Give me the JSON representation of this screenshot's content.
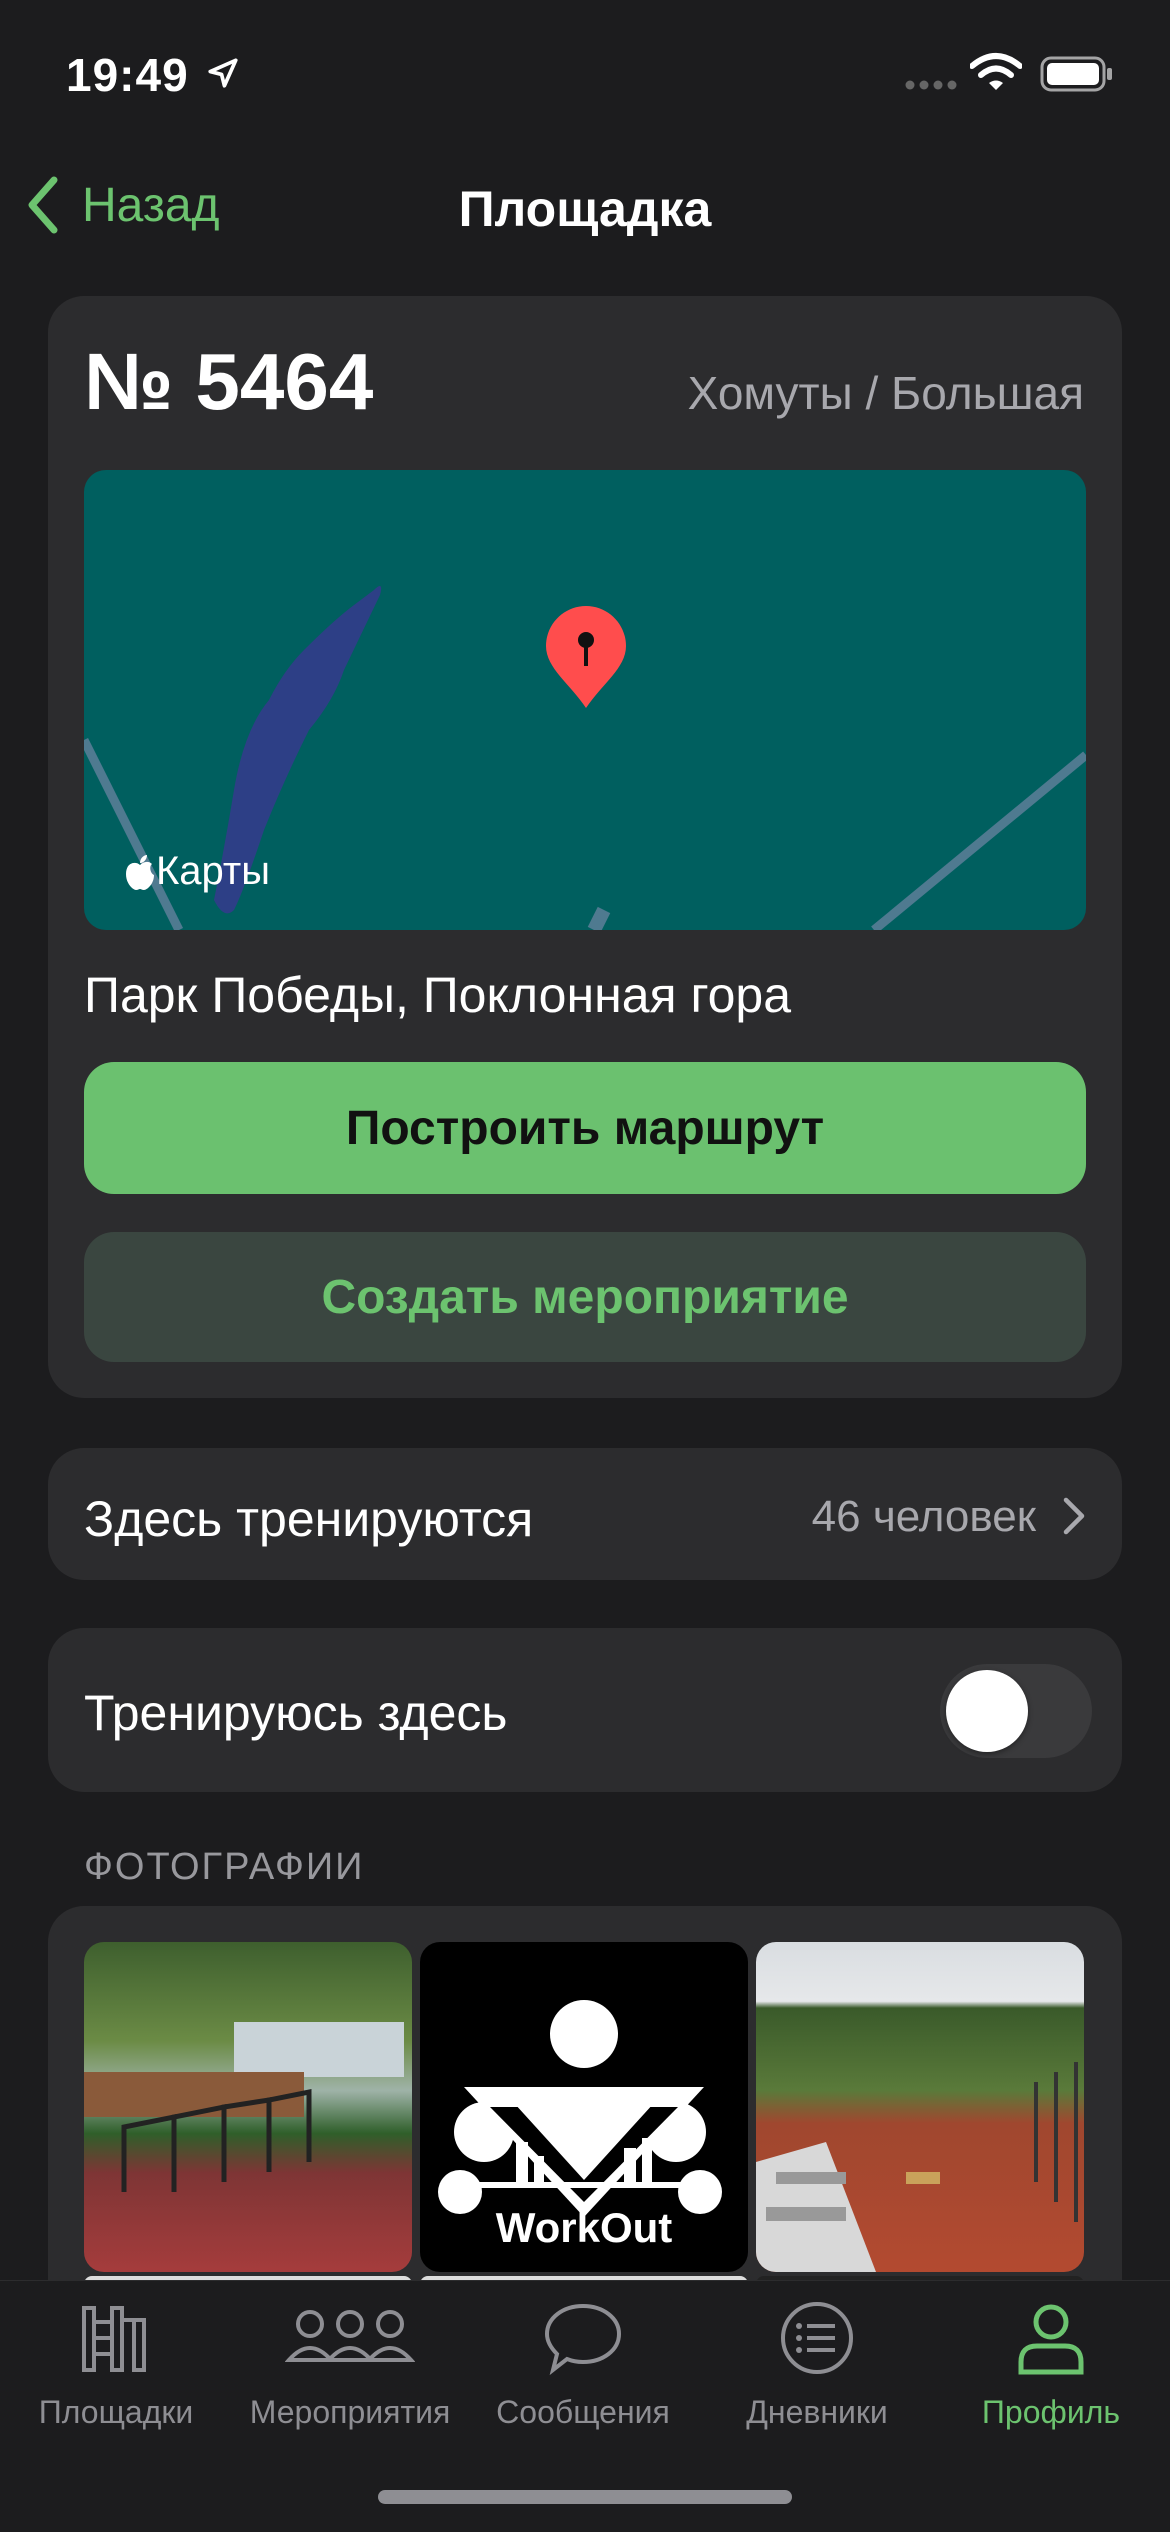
{
  "status_bar": {
    "time": "19:49"
  },
  "nav": {
    "back_label": "Назад",
    "title": "Площадка"
  },
  "ground": {
    "number": "№ 5464",
    "category": "Хомуты / Большая",
    "maps_label": "Карты",
    "address": "Парк Победы, Поклонная гора",
    "route_button": "Построить маршрут",
    "create_event_button": "Создать мероприятие"
  },
  "training_here": {
    "label": "Здесь тренируются",
    "count": "46 человек"
  },
  "train_toggle": {
    "label": "Тренируюсь здесь",
    "on": false
  },
  "photos": {
    "header": "ФОТОГРАФИИ",
    "workout_logo_text": "WorkOut"
  },
  "tabs": [
    {
      "label": "Площадки",
      "icon": "ladder-icon"
    },
    {
      "label": "Мероприятия",
      "icon": "people-icon"
    },
    {
      "label": "Сообщения",
      "icon": "chat-bubble-icon"
    },
    {
      "label": "Дневники",
      "icon": "list-icon"
    },
    {
      "label": "Профиль",
      "icon": "person-icon",
      "active": true
    }
  ],
  "colors": {
    "accent": "#6bc16f",
    "background": "#1c1c1e",
    "card": "#2c2c2e",
    "map": "#005f5f",
    "pin": "#ff4d4d"
  }
}
